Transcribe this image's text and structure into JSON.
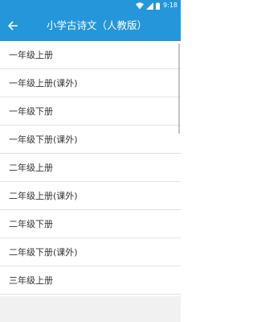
{
  "status_bar": {
    "time": "9:18",
    "icons": [
      "wifi-icon",
      "signal-icon",
      "battery-icon"
    ],
    "background_color": "#2596d9"
  },
  "toolbar": {
    "title": "小学古诗文（人教版）",
    "back_icon": "arrow-left-icon",
    "background_color": "#2596d9"
  },
  "list": {
    "items": [
      {
        "label": "一年级上册"
      },
      {
        "label": "一年级上册(课外)"
      },
      {
        "label": "一年级下册"
      },
      {
        "label": "一年级下册(课外)"
      },
      {
        "label": "二年级上册"
      },
      {
        "label": "二年级上册(课外)"
      },
      {
        "label": "二年级下册"
      },
      {
        "label": "二年级下册(课外)"
      },
      {
        "label": "三年级上册"
      }
    ]
  }
}
